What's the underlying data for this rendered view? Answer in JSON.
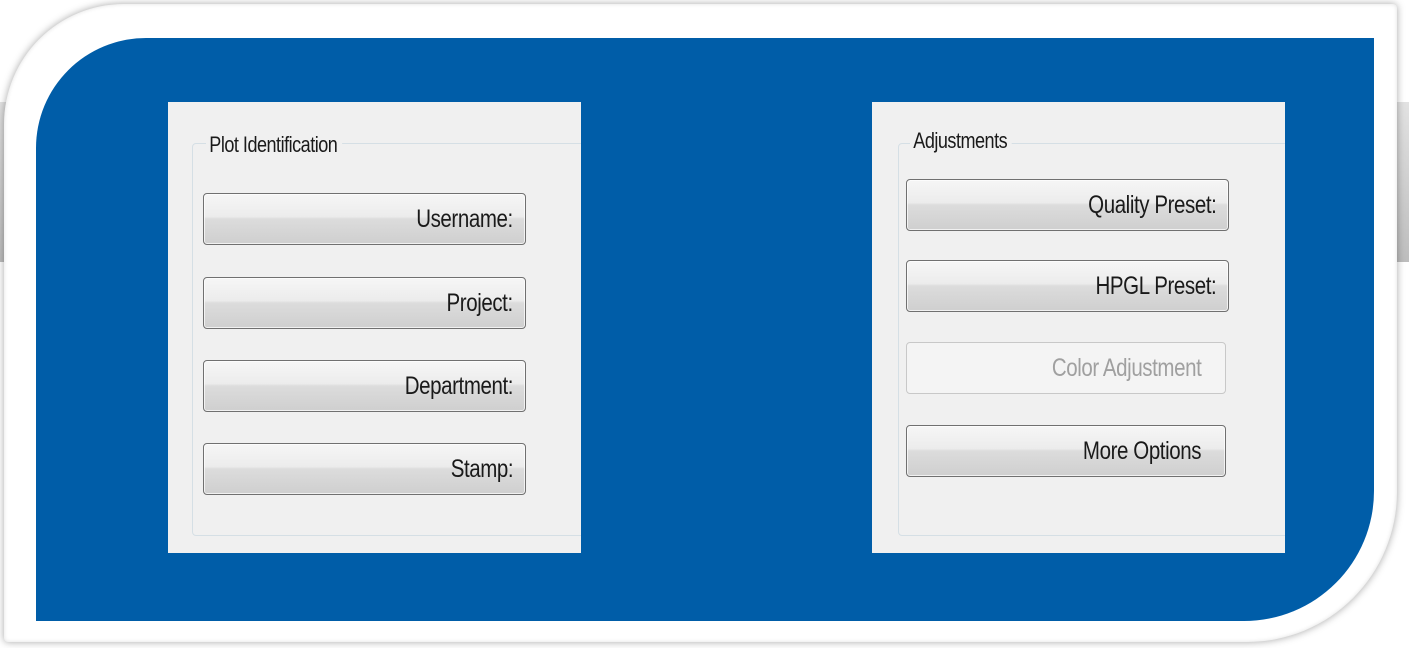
{
  "plot_identification": {
    "title": "Plot Identification",
    "buttons": [
      {
        "label": "Username:"
      },
      {
        "label": "Project:"
      },
      {
        "label": "Department:"
      },
      {
        "label": "Stamp:"
      }
    ]
  },
  "adjustments": {
    "title": "Adjustments",
    "buttons": [
      {
        "label": "Quality Preset:",
        "enabled": true
      },
      {
        "label": "HPGL Preset:",
        "enabled": true
      },
      {
        "label": "Color Adjustment",
        "enabled": false
      },
      {
        "label": "More Options",
        "enabled": true
      }
    ]
  },
  "colors": {
    "card_blue": "#005da8",
    "panel_bg": "#f0f0f0",
    "disabled_text": "#a0a0a0"
  }
}
